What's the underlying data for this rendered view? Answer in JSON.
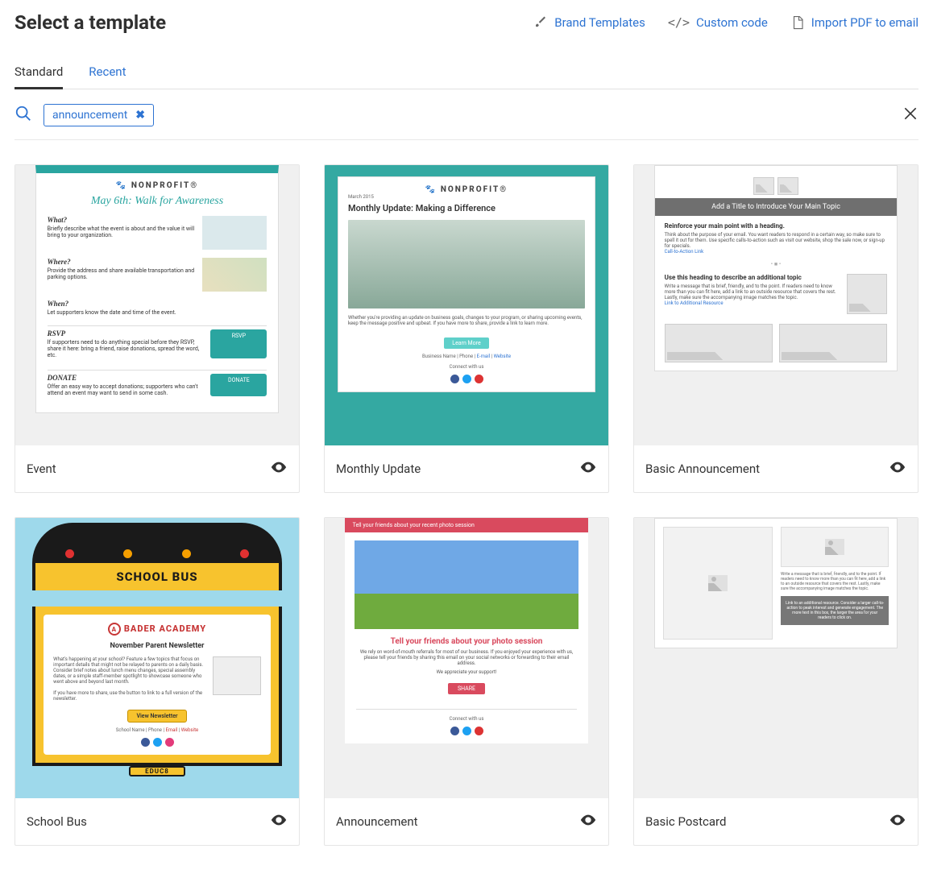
{
  "header": {
    "title": "Select a template",
    "actions": {
      "brand": "Brand Templates",
      "code": "Custom code",
      "pdf": "Import PDF to email"
    }
  },
  "tabs": {
    "standard": "Standard",
    "recent": "Recent"
  },
  "search": {
    "chip": "announcement"
  },
  "cards": [
    {
      "title": "Event"
    },
    {
      "title": "Monthly Update"
    },
    {
      "title": "Basic Announcement"
    },
    {
      "title": "School Bus"
    },
    {
      "title": "Announcement"
    },
    {
      "title": "Basic Postcard"
    }
  ],
  "thumbs": {
    "event": {
      "brand": "NONPROFIT",
      "heading": "May 6th: Walk for Awareness",
      "what_h": "What?",
      "what_t": "Briefly describe what the event is about and the value it will bring to your organization.",
      "where_h": "Where?",
      "where_t": "Provide the address and share available transportation and parking options.",
      "when_h": "When?",
      "when_t": "Let supporters know the date and time of the event.",
      "rsvp_h": "RSVP",
      "rsvp_t": "If supporters need to do anything special before they RSVP, share it here: bring a friend, raise donations, spread the word, etc.",
      "rsvp_btn": "RSVP",
      "donate_h": "DONATE",
      "donate_t": "Offer an easy way to accept donations; supporters who can't attend an event may want to send in some cash.",
      "donate_btn": "DONATE"
    },
    "monthly": {
      "brand": "NONPROFIT",
      "date": "March 2015",
      "heading": "Monthly Update: Making a Difference",
      "body": "Whether you're providing an update on business goals, changes to your program, or sharing upcoming events, keep the message positive and upbeat. If you have more to share, provide a link to learn more.",
      "cta": "Learn More",
      "meta_prefix": "Business Name | Phone | ",
      "meta_email": "E-mail",
      "meta_sep": " | ",
      "meta_site": "Website",
      "connect": "Connect with us"
    },
    "basic": {
      "band": "Add a Title to Introduce Your Main Topic",
      "h1": "Reinforce your main point with a heading.",
      "p1": "Think about the purpose of your email. You want readers to respond in a certain way, so make sure to spell it out for them. Use specific calls-to-action such as visit our website, shop the sale now, or sign-up for specials.",
      "link1": "Call-to-Action Link",
      "h2": "Use this heading to describe an additional topic",
      "p2": "Write a message that is brief, friendly, and to the point. If readers need to know more than you can fit here, add a link to an outside resource that covers the rest. Lastly, make sure the accompanying image matches the topic.",
      "link2": "Link to Additional Resource"
    },
    "bus": {
      "band": "SCHOOL BUS",
      "brand": "BADER ACADEMY",
      "heading": "November Parent Newsletter",
      "body": "What's happening at your school? Feature a few topics that focus on important details that might not be relayed to parents on a daily basis. Consider brief notes about lunch menu changes, special assembly dates, or a simple staff-member spotlight to showcase someone who went above and beyond last month.",
      "body2": "If you have more to share, use the button to link to a full version of the newsletter.",
      "btn": "View Newsletter",
      "meta_prefix": "School Name | Phone | ",
      "meta_email": "Email",
      "meta_sep": " | ",
      "meta_site": "Website",
      "plate": "EDUC8"
    },
    "ann": {
      "band": "Tell your friends about your recent photo session",
      "heading": "Tell your friends about your photo session",
      "body": "We rely on word-of-mouth referrals for most of our business. If you enjoyed your experience with us, please tell your friends by sharing this email on your social networks or forwarding to their email address.",
      "body2": "We appreciate your support!",
      "btn": "SHARE",
      "connect": "Connect with us"
    },
    "postcard": {
      "text1": "Write a message that is brief, friendly, and to the point. If readers need to know more than you can fit here, add a link to an outside resource that covers the rest. Lastly, make sure the accompanying image matches the topic.",
      "band": "Link to an additional resource. Consider a larger call-to-action to peak interest and generate engagement. The more text in this box, the larger the area for your readers to click on."
    }
  }
}
